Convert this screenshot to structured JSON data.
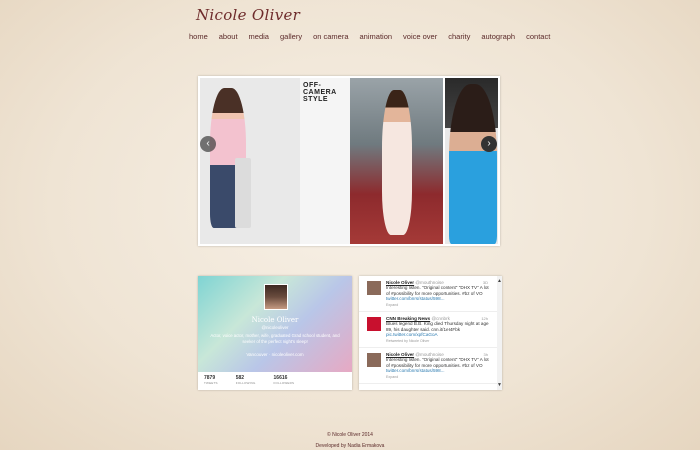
{
  "site": {
    "title": "Nicole Oliver"
  },
  "nav": [
    "home",
    "about",
    "media",
    "gallery",
    "on camera",
    "animation",
    "voice over",
    "charity",
    "autograph",
    "contact"
  ],
  "carousel": {
    "magazine_title": "OFF-CAMERA STYLE",
    "prev_icon": "chevron-left-icon",
    "next_icon": "chevron-right-icon"
  },
  "profile": {
    "name": "Nicole Oliver",
    "handle": "@nicoleoliver",
    "bio": "Actor, voice actor, mother, wife, graduated Grad school student, and seeker of the perfect night's sleep!",
    "location": "Vancouver · nicoleoliver.com",
    "stats": [
      {
        "value": "7879",
        "label": "TWEETS"
      },
      {
        "value": "582",
        "label": "FOLLOWING"
      },
      {
        "value": "16616",
        "label": "FOLLOWERS"
      }
    ]
  },
  "tweets": [
    {
      "name": "Nicole Oliver",
      "handle": "@mouthnoise",
      "time": "3D",
      "text": "Interesting listen. \"Original content\" \"DHX TV\" A lot of #possibility for more opportunities. #bz of VO",
      "link": "twitter.com/bnrs/status/598...",
      "footer": "Expand"
    },
    {
      "name": "CNN Breaking News",
      "handle": "@cnnbrk",
      "time": "12h",
      "text": "Blues legend B.B. King died Thursday night at age 89, his daughter said. cnn.it/1eI4Fbk",
      "link": "pic.twitter.com/xpfCaGoA",
      "footer": "Retweeted by Nicole Oliver"
    },
    {
      "name": "Nicole Oliver",
      "handle": "@mouthnoise",
      "time": "3h",
      "text": "Interesting listen. \"Original content\" \"DHX TV\" A lot of #possibility for more opportunities. #bz of VO",
      "link": "twitter.com/bnrs/status/598...",
      "footer": "Expand"
    }
  ],
  "footer": {
    "copyright": "© Nicole Oliver 2014",
    "credit": "Developed by Nadia Ermakova"
  }
}
